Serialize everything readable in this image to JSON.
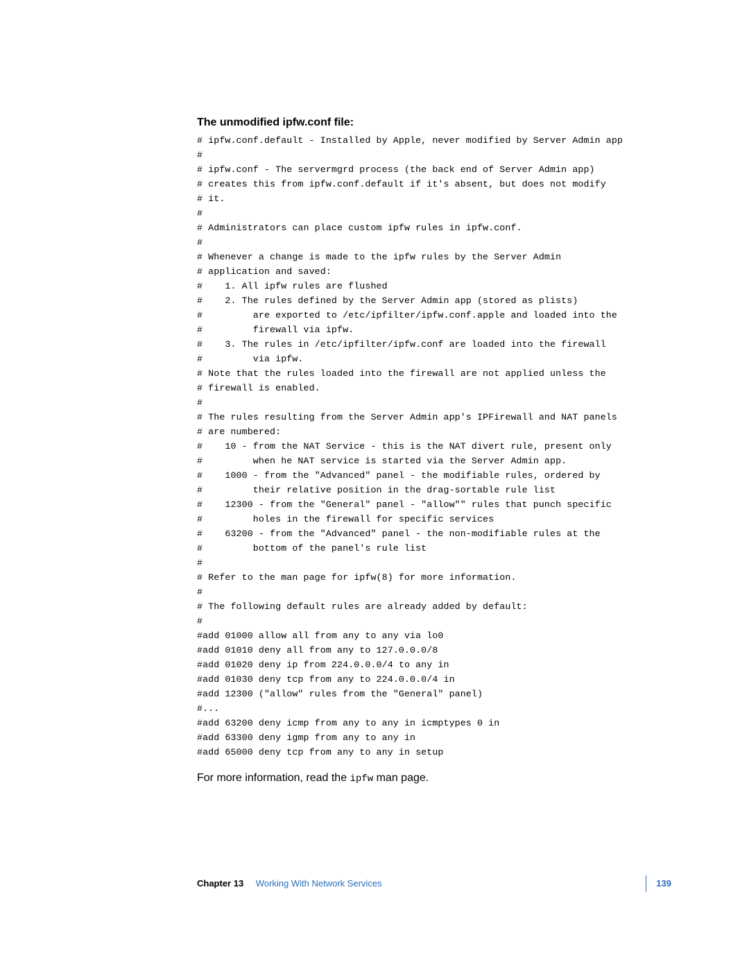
{
  "heading": "The unmodified ipfw.conf file:",
  "code": "# ipfw.conf.default - Installed by Apple, never modified by Server Admin app\n#\n# ipfw.conf - The servermgrd process (the back end of Server Admin app)\n# creates this from ipfw.conf.default if it's absent, but does not modify\n# it.\n#\n# Administrators can place custom ipfw rules in ipfw.conf.\n#\n# Whenever a change is made to the ipfw rules by the Server Admin\n# application and saved:\n#    1. All ipfw rules are flushed\n#    2. The rules defined by the Server Admin app (stored as plists)\n#         are exported to /etc/ipfilter/ipfw.conf.apple and loaded into the\n#         firewall via ipfw.\n#    3. The rules in /etc/ipfilter/ipfw.conf are loaded into the firewall\n#         via ipfw.\n# Note that the rules loaded into the firewall are not applied unless the\n# firewall is enabled.\n#\n# The rules resulting from the Server Admin app's IPFirewall and NAT panels\n# are numbered:\n#    10 - from the NAT Service - this is the NAT divert rule, present only\n#         when he NAT service is started via the Server Admin app.\n#    1000 - from the \"Advanced\" panel - the modifiable rules, ordered by\n#         their relative position in the drag-sortable rule list\n#    12300 - from the \"General\" panel - \"allow\"\" rules that punch specific\n#         holes in the firewall for specific services\n#    63200 - from the \"Advanced\" panel - the non-modifiable rules at the\n#         bottom of the panel's rule list\n#\n# Refer to the man page for ipfw(8) for more information.\n#\n# The following default rules are already added by default:\n#\n#add 01000 allow all from any to any via lo0\n#add 01010 deny all from any to 127.0.0.0/8\n#add 01020 deny ip from 224.0.0.0/4 to any in\n#add 01030 deny tcp from any to 224.0.0.0/4 in\n#add 12300 (\"allow\" rules from the \"General\" panel)\n#...\n#add 63200 deny icmp from any to any in icmptypes 0 in\n#add 63300 deny igmp from any to any in\n#add 65000 deny tcp from any to any in setup",
  "footnote_before": "For more information, read the ",
  "footnote_code": "ipfw",
  "footnote_after": " man page.",
  "footer": {
    "chapter_label": "Chapter 13",
    "chapter_title": "Working With Network Services",
    "page_number": "139"
  }
}
